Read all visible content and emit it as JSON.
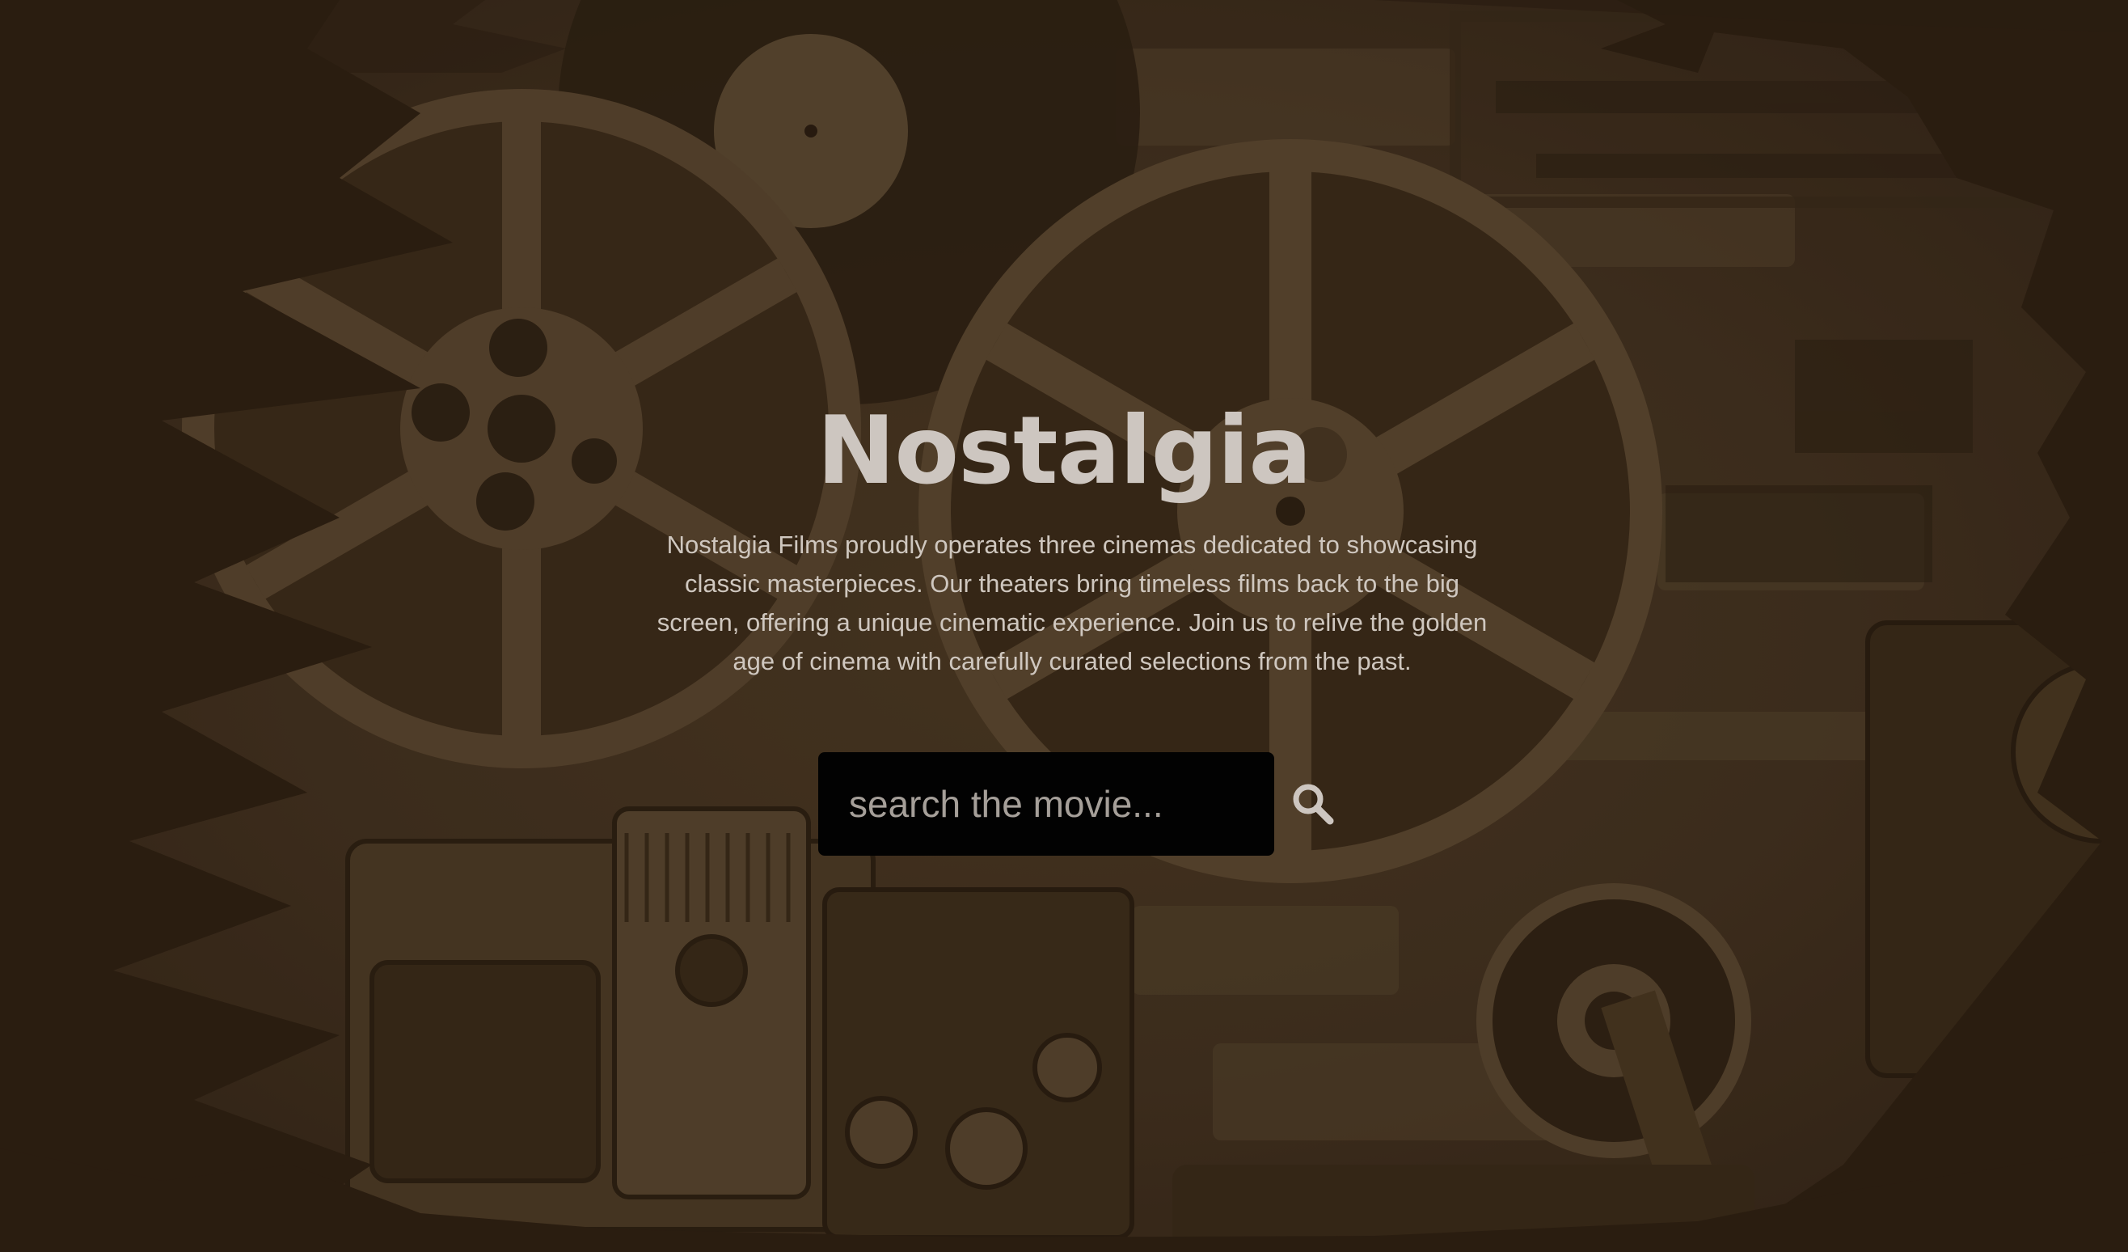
{
  "hero": {
    "title": "Nostalgia",
    "description": "Nostalgia Films proudly operates three cinemas dedicated to showcasing classic masterpieces. Our theaters bring timeless films back to the big screen, offering a unique cinematic experience. Join us to relive the golden age of cinema with carefully curated selections from the past.",
    "background_image": "vintage film reels and projectors (sepia)"
  },
  "search": {
    "placeholder": "search the movie...",
    "value": "",
    "button_icon": "search-icon"
  },
  "colors": {
    "background_dark": "#2e1f12",
    "overlay_brown": "#463421",
    "title_text": "#cdc6c0",
    "body_text": "#cfc7bf",
    "input_bg": "#020202",
    "placeholder_text": "#a59f99",
    "icon": "#cdc6c0"
  }
}
